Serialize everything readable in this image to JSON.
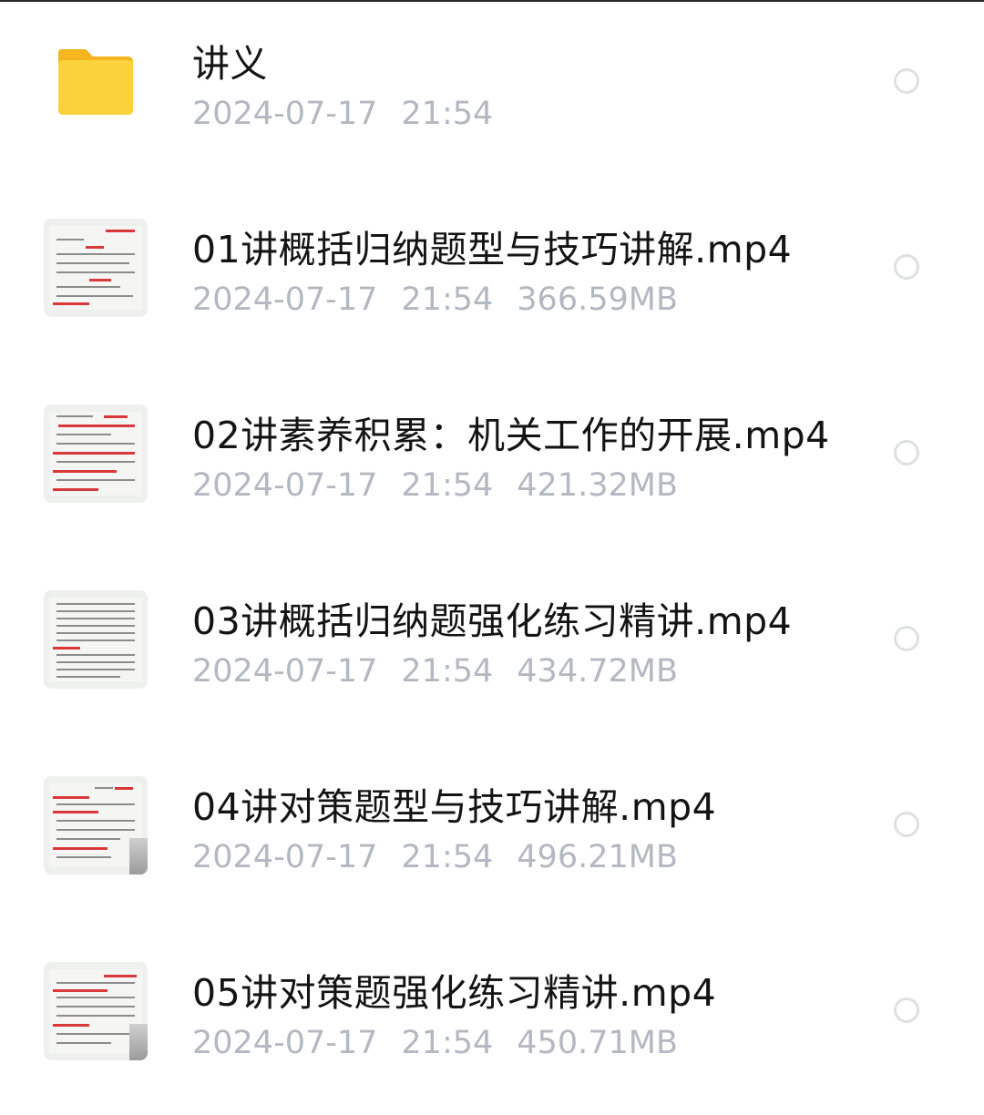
{
  "files": [
    {
      "name": "讲义",
      "date": "2024-07-17",
      "time": "21:54",
      "size": "",
      "icon": "folder-icon"
    },
    {
      "name": "01讲概括归纳题型与技巧讲解.mp4",
      "date": "2024-07-17",
      "time": "21:54",
      "size": "366.59MB",
      "icon": "video-thumbnail"
    },
    {
      "name": "02讲素养积累：机关工作的开展.mp4",
      "date": "2024-07-17",
      "time": "21:54",
      "size": "421.32MB",
      "icon": "video-thumbnail"
    },
    {
      "name": "03讲概括归纳题强化练习精讲.mp4",
      "date": "2024-07-17",
      "time": "21:54",
      "size": "434.72MB",
      "icon": "video-thumbnail"
    },
    {
      "name": "04讲对策题型与技巧讲解.mp4",
      "date": "2024-07-17",
      "time": "21:54",
      "size": "496.21MB",
      "icon": "video-thumbnail"
    },
    {
      "name": "05讲对策题强化练习精讲.mp4",
      "date": "2024-07-17",
      "time": "21:54",
      "size": "450.71MB",
      "icon": "video-thumbnail"
    }
  ],
  "colors": {
    "name_text": "#141414",
    "meta_text": "#b4b8c0",
    "folder_yellow": "#f9c825",
    "radio_border": "#dfe0e4"
  }
}
